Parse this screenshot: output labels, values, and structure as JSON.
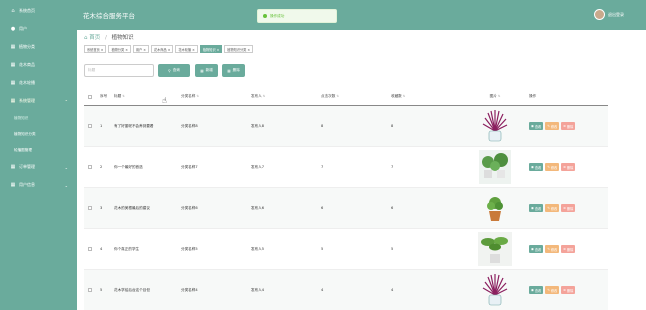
{
  "sidebar": {
    "items": [
      {
        "label": "系统首页",
        "icon": "home-icon"
      },
      {
        "label": "用户",
        "icon": "user-icon"
      },
      {
        "label": "植物分类",
        "icon": "grid-icon"
      },
      {
        "label": "花木商品",
        "icon": "grid-icon"
      },
      {
        "label": "花木轮播",
        "icon": "grid-icon"
      },
      {
        "label": "系统管理",
        "icon": "grid-icon",
        "expanded": true
      }
    ],
    "subitems": [
      "植物知识",
      "植物知识分类",
      "轮播图管理"
    ],
    "bottom_items": [
      {
        "label": "订单管理",
        "icon": "grid-icon"
      },
      {
        "label": "用户信息",
        "icon": "grid-icon"
      }
    ]
  },
  "header": {
    "title": "花木综合服务平台",
    "toast": "操作成功",
    "logout": "退出登录"
  },
  "breadcrumb": {
    "home": "首页",
    "current": "植物知识"
  },
  "tags": [
    "系统首页 ×",
    "植物分类 ×",
    "用户 ×",
    "花木商品 ×",
    "花木轮播 ×",
    "植物知识 ×",
    "植物知识分类 ×"
  ],
  "search": {
    "placeholder": "标题",
    "query_label": "查询",
    "add_label": "新增",
    "delete_label": "删除"
  },
  "table": {
    "headers": [
      "序号",
      "标题",
      "分类名称",
      "发布人",
      "点击次数",
      "收藏数",
      "图片",
      "操作"
    ],
    "rows": [
      {
        "no": "1",
        "title": "有了好墨呢不会养到要看",
        "cat": "分类名称8",
        "pub": "发布人8",
        "click": "8",
        "fav": "8",
        "img": "purple-plant"
      },
      {
        "no": "2",
        "title": "你一个最好的首选",
        "cat": "分类名称7",
        "pub": "发布人7",
        "click": "7",
        "fav": "7",
        "img": "green-plants"
      },
      {
        "no": "3",
        "title": "花木的美根最后的建议",
        "cat": "分类名称6",
        "pub": "发布人6",
        "click": "6",
        "fav": "6",
        "img": "small-plant"
      },
      {
        "no": "4",
        "title": "你个真正的学生",
        "cat": "分类名称5",
        "pub": "发布人5",
        "click": "5",
        "fav": "5",
        "img": "leafy-plant"
      },
      {
        "no": "5",
        "title": "花木学给后台这个目但",
        "cat": "分类名称4",
        "pub": "发布人4",
        "click": "4",
        "fav": "4",
        "img": "purple-plant"
      }
    ],
    "actions": {
      "view": "查看",
      "edit": "修改",
      "del": "删除"
    }
  },
  "colors": {
    "primary": "#6aab9c",
    "edit": "#f3b87b",
    "delete": "#f4a39a"
  }
}
